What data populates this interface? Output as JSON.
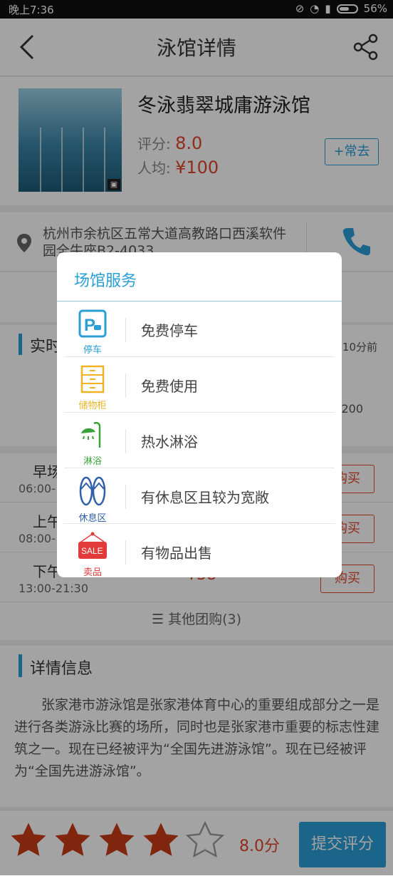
{
  "status_bar": {
    "time": "晚上7:36",
    "battery": "56%"
  },
  "header": {
    "title": "泳馆详情"
  },
  "venue": {
    "name": "冬泳翡翠城庸游泳馆",
    "rating_label": "评分:",
    "rating_value": "8.0",
    "avg_label": "人均:",
    "avg_value": "¥100",
    "follow_label": "+常去"
  },
  "address": {
    "text": "杭州市余杭区五常大道高教路口西溪软件园全牛座B2-4033"
  },
  "realtime": {
    "label": "实时",
    "ago": "10分前",
    "count": "200"
  },
  "group_buys": {
    "items": [
      {
        "name": "早场",
        "time": "06:00-",
        "price": "",
        "buy": "购买"
      },
      {
        "name": "上午",
        "time": "08:00-",
        "price": "",
        "buy": "购买"
      },
      {
        "name": "下午",
        "time": "13:00-21:30",
        "price": "¥38",
        "buy": "购买"
      }
    ],
    "more": "其他团购(3)"
  },
  "details": {
    "label": "详情信息",
    "description": "张家港市游泳馆是张家港体育中心的重要组成部分之一是进行各类游泳比赛的场所，同时也是张家港市重要的标志性建筑之一。现在已经被评为“全国先进游泳馆”。现在已经被评为“全国先进游泳馆”。"
  },
  "bottom": {
    "stars_filled": 4,
    "stars_total": 5,
    "score": "8.0分",
    "submit": "提交评分"
  },
  "modal": {
    "title": "场馆服务",
    "services": [
      {
        "icon": "parking-icon",
        "caption": "停车",
        "text": "免费停车",
        "color": "#2a9fd6"
      },
      {
        "icon": "locker-icon",
        "caption": "储物柜",
        "text": "免费使用",
        "color": "#f0b429"
      },
      {
        "icon": "shower-icon",
        "caption": "淋浴",
        "text": "热水淋浴",
        "color": "#3aa23a"
      },
      {
        "icon": "slippers-icon",
        "caption": "休息区",
        "text": "有休息区且较为宽敞",
        "color": "#2f5fa8"
      },
      {
        "icon": "sale-icon",
        "caption": "卖品",
        "text": "有物品出售",
        "color": "#e23a3a"
      }
    ]
  },
  "colors": {
    "accent": "#2a9fd6",
    "price": "#e2452b"
  }
}
